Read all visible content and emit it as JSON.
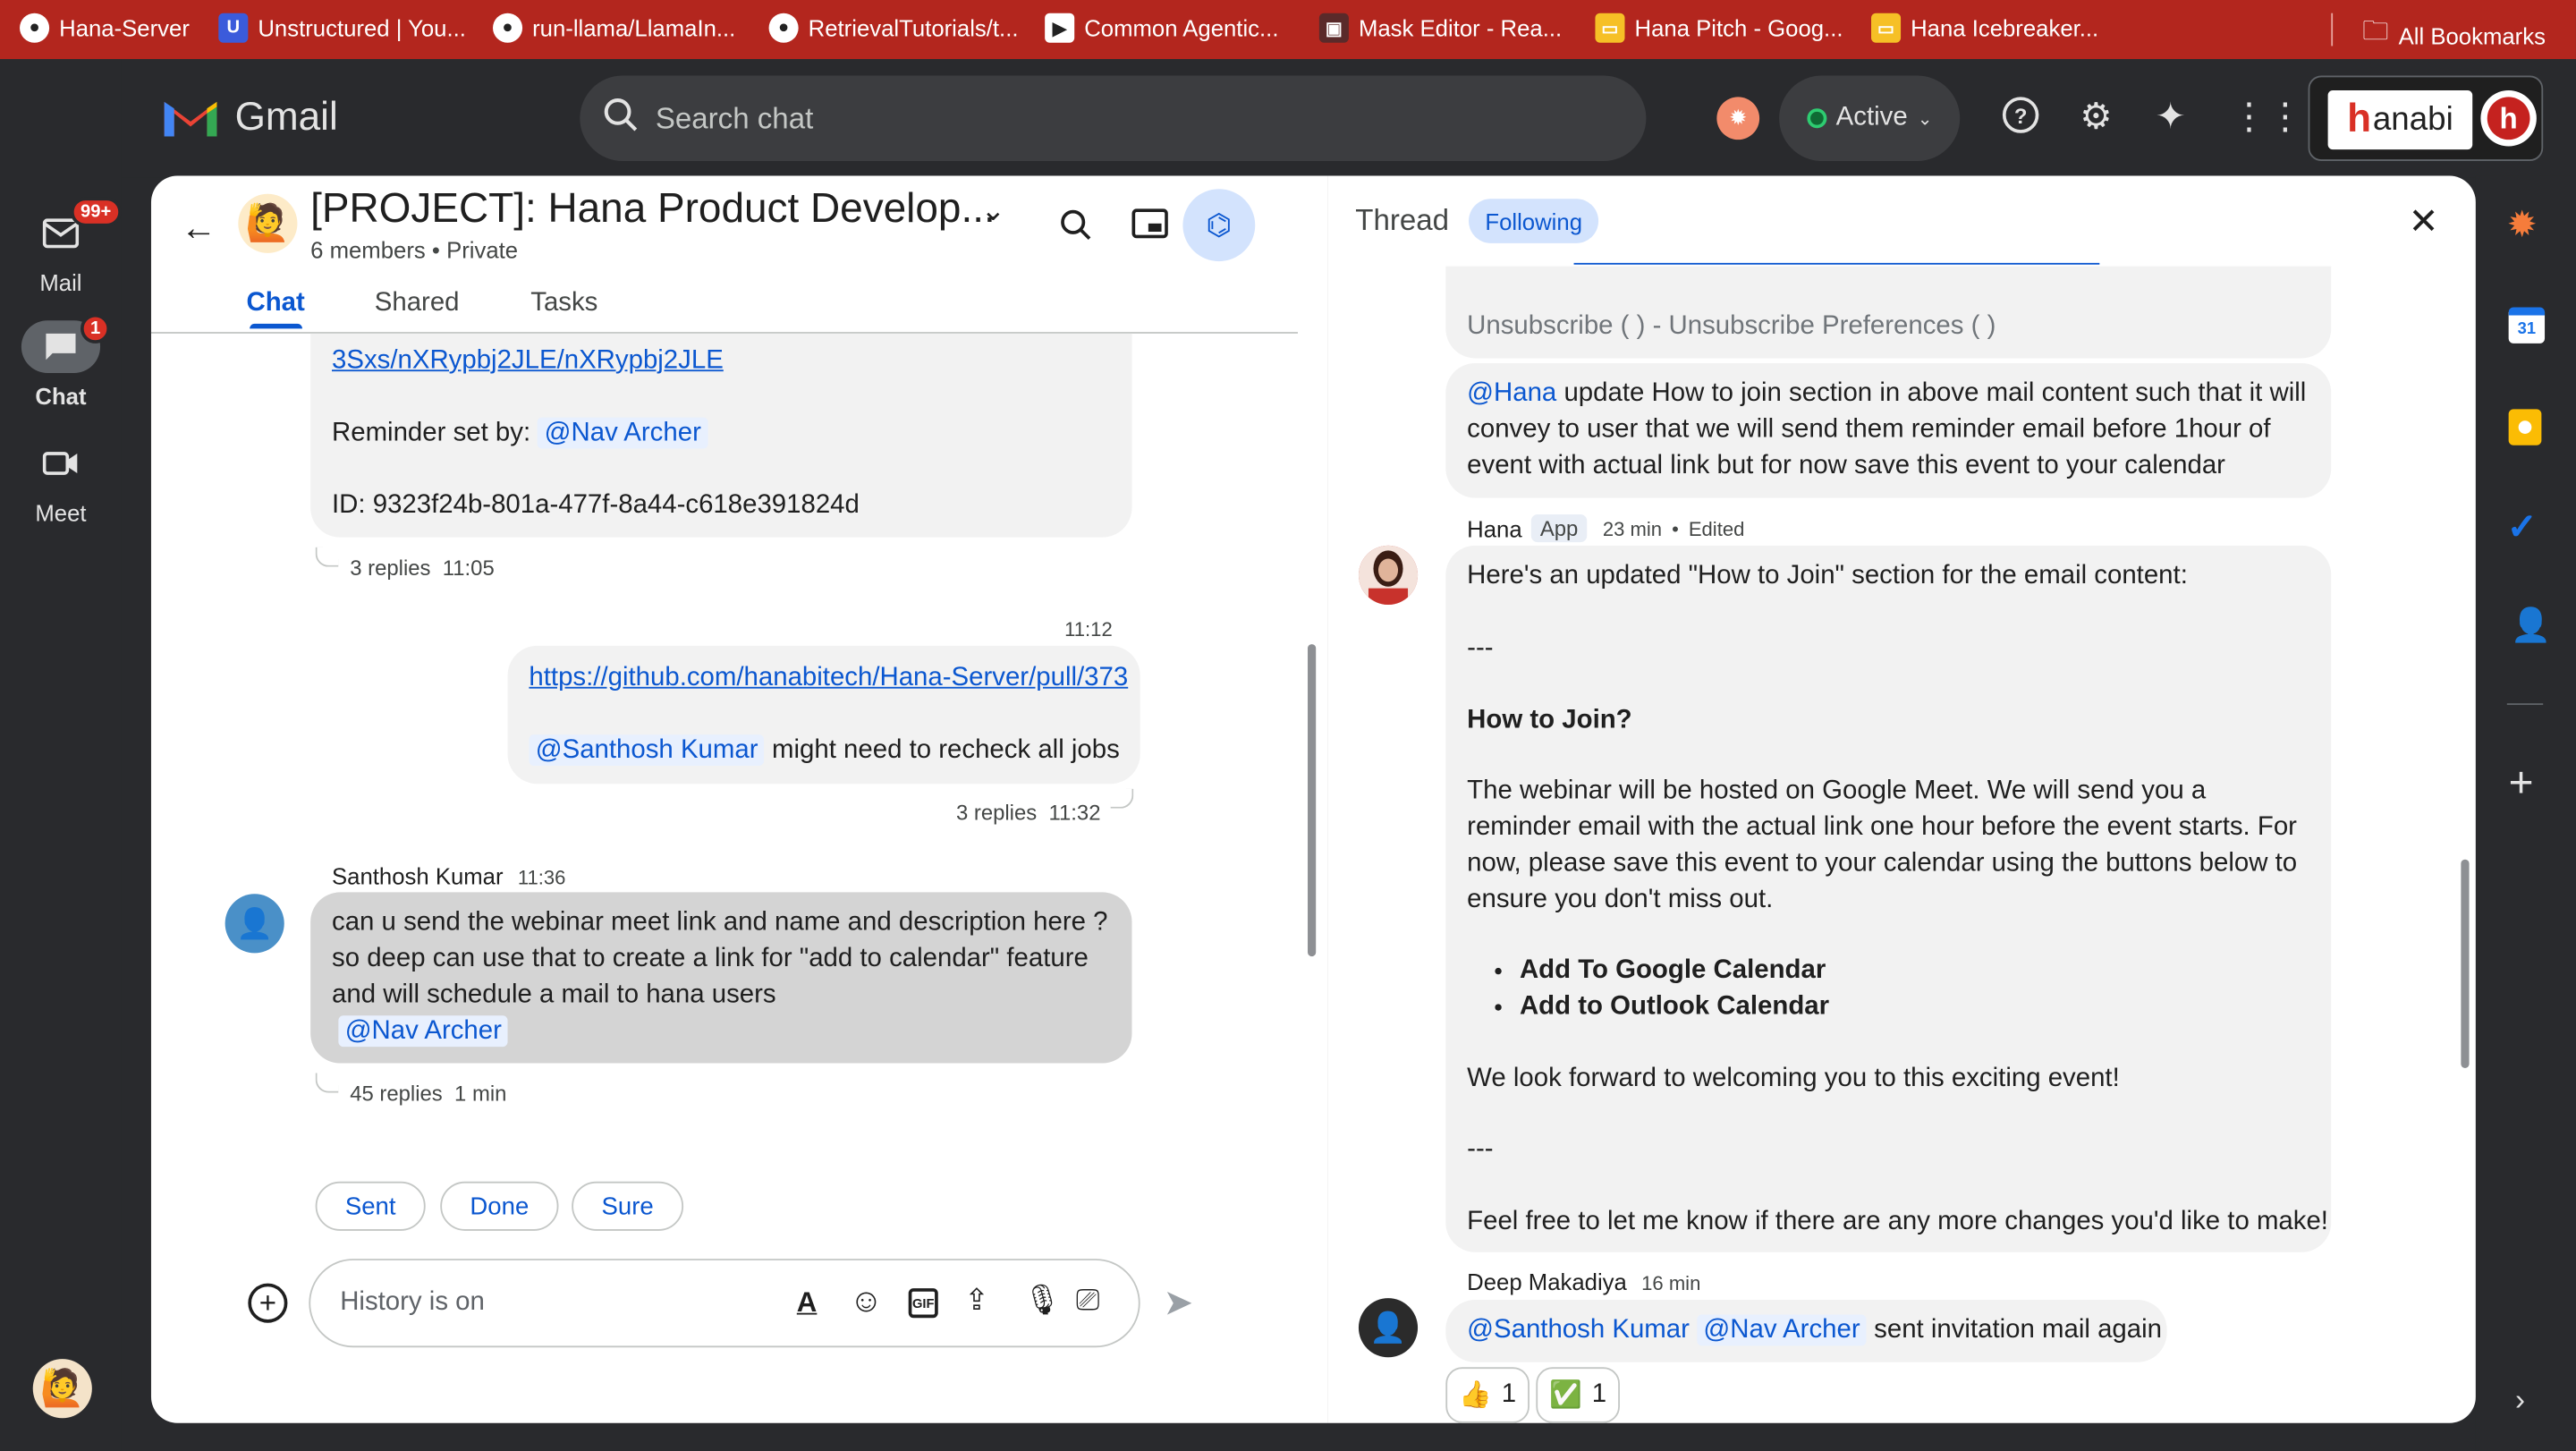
{
  "bookmarks": [
    {
      "label": "Hana-Server",
      "icon": "github-icon"
    },
    {
      "label": "Unstructured | You...",
      "icon": "unstructured-icon"
    },
    {
      "label": "run-llama/LlamaIn...",
      "icon": "github-icon"
    },
    {
      "label": "RetrievalTutorials/t...",
      "icon": "github-icon"
    },
    {
      "label": "Common Agentic...",
      "icon": "video-icon"
    },
    {
      "label": "Mask Editor - Rea...",
      "icon": "image-icon"
    },
    {
      "label": "Hana Pitch - Goog...",
      "icon": "slides-icon"
    },
    {
      "label": "Hana Icebreaker...",
      "icon": "slides-icon"
    },
    {
      "label": "All Bookmarks",
      "icon": "folder-icon"
    }
  ],
  "app": {
    "name": "Gmail"
  },
  "search": {
    "placeholder": "Search chat"
  },
  "status": {
    "label": "Active"
  },
  "account": {
    "brand_text": "anabi",
    "brand_mark": "h",
    "avatar": "h"
  },
  "rail": {
    "mail": {
      "label": "Mail",
      "badge": "99+"
    },
    "chat": {
      "label": "Chat",
      "badge": "1"
    },
    "meet": {
      "label": "Meet"
    }
  },
  "space": {
    "title": "[PROJECT]: Hana Product Develop...",
    "members": "6 members",
    "privacy": "Private",
    "emoji": "🙋"
  },
  "tabs": [
    "Chat",
    "Shared",
    "Tasks"
  ],
  "chat": {
    "msg1": {
      "link_partial": "3Sxs/nXRypbj2JLE/nXRypbj2JLE",
      "reminder_label": "Reminder set by:",
      "reminder_mention": "@Nav Archer",
      "id_line": "ID: 9323f24b-801a-477f-8a44-c618e391824d",
      "replies": "3 replies",
      "time": "11:05"
    },
    "msg2": {
      "time": "11:12",
      "link": "https://github.com/hanabitech/Hana-Server/pull/373",
      "mention": "@Santhosh Kumar",
      "text": "might need to recheck all jobs",
      "replies": "3 replies",
      "reply_time": "11:32"
    },
    "msg3": {
      "author": "Santhosh Kumar",
      "time": "11:36",
      "line1": "can u send the webinar meet link and name and description  here  ?",
      "line2": "so deep can use that to create a link for \"add to calendar\" feature",
      "line3": "and will schedule a mail to hana users",
      "mention": "@Nav Archer",
      "replies": "45 replies",
      "reply_time": "1 min"
    },
    "smart_replies": [
      "Sent",
      "Done",
      "Sure"
    ],
    "composer": {
      "placeholder": "History is on"
    }
  },
  "thread": {
    "title": "Thread",
    "following": "Following",
    "unsubscribe": "Unsubscribe ( ) - Unsubscribe Preferences ( )",
    "request": {
      "mention": "@Hana",
      "text": "update How to join section in above mail content such that it will convey to user that we will send them reminder email before 1hour of event with actual link but for now save this event to your calendar"
    },
    "hana": {
      "author": "Hana",
      "badge": "App",
      "time": "23 min",
      "edited": "Edited",
      "intro": "Here's an updated \"How to Join\" section for the email content:",
      "sep": "---",
      "heading": "How to Join?",
      "body": "The webinar will be hosted on Google Meet. We will send you a reminder email with the actual link one hour before the event starts. For now, please save this event to your calendar using the buttons below to ensure you don't miss out.",
      "bullets": [
        "Add To Google Calendar",
        "Add to Outlook Calendar"
      ],
      "closing": "We look forward to welcoming you to this exciting event!",
      "sep2": "---",
      "final": "Feel free to let me know if there are any more changes you'd like to make!"
    },
    "deep": {
      "author": "Deep Makadiya",
      "time": "16 min",
      "mention1": "@Santhosh Kumar",
      "mention2": "@Nav Archer",
      "text": "sent invitation mail again",
      "reactions": [
        {
          "emoji": "👍",
          "count": "1"
        },
        {
          "emoji": "✅",
          "count": "1"
        }
      ]
    }
  },
  "colors": {
    "bookmark_bar": "#b3261e",
    "accent": "#0b57d0",
    "dark_bg": "#292a2d",
    "bubble": "#f2f2f2"
  }
}
